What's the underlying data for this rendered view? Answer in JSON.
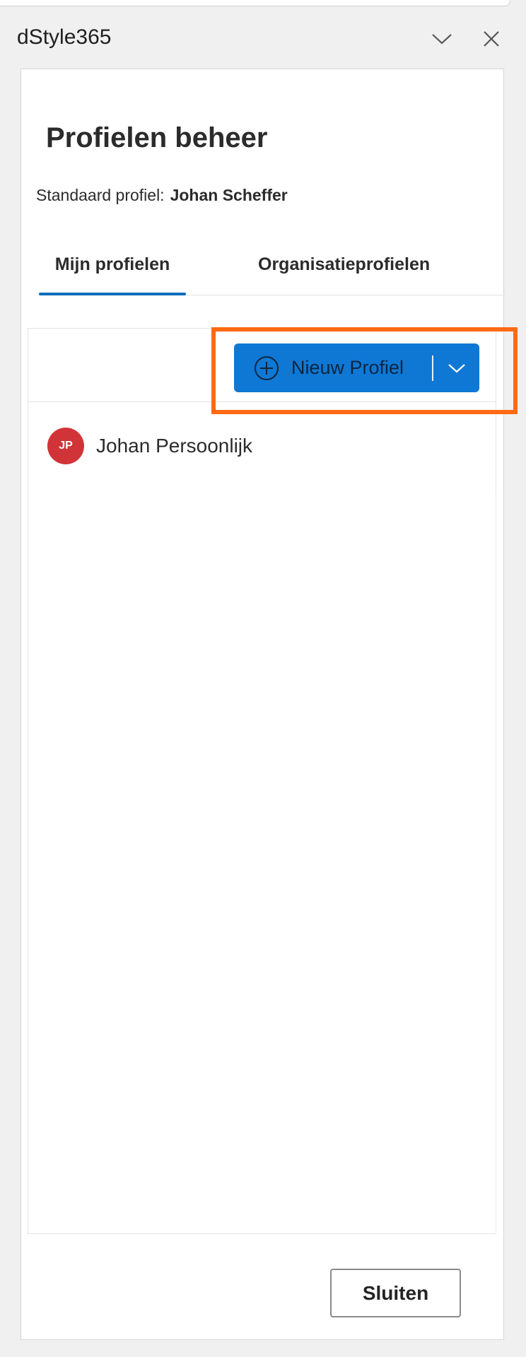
{
  "pane": {
    "title": "dStyle365",
    "collapse_icon": "chevron-down-icon",
    "close_icon": "close-icon"
  },
  "page": {
    "title": "Profielen beheer",
    "default_profile_label": "Standaard profiel:",
    "default_profile_value": "Johan Scheffer"
  },
  "tabs": [
    {
      "label": "Mijn profielen",
      "active": true
    },
    {
      "label": "Organisatieprofielen",
      "active": false
    }
  ],
  "toolbar": {
    "new_profile_label": "Nieuw Profiel",
    "new_profile_icon": "plus-circle-icon",
    "dropdown_icon": "chevron-down-icon"
  },
  "profiles": [
    {
      "initials": "JP",
      "name": "Johan Persoonlijk"
    }
  ],
  "footer": {
    "close_label": "Sluiten"
  },
  "colors": {
    "accent": "#0f78d4",
    "tab_underline": "#0f6cbd",
    "avatar": "#d13438",
    "highlight": "#ff6a12"
  }
}
